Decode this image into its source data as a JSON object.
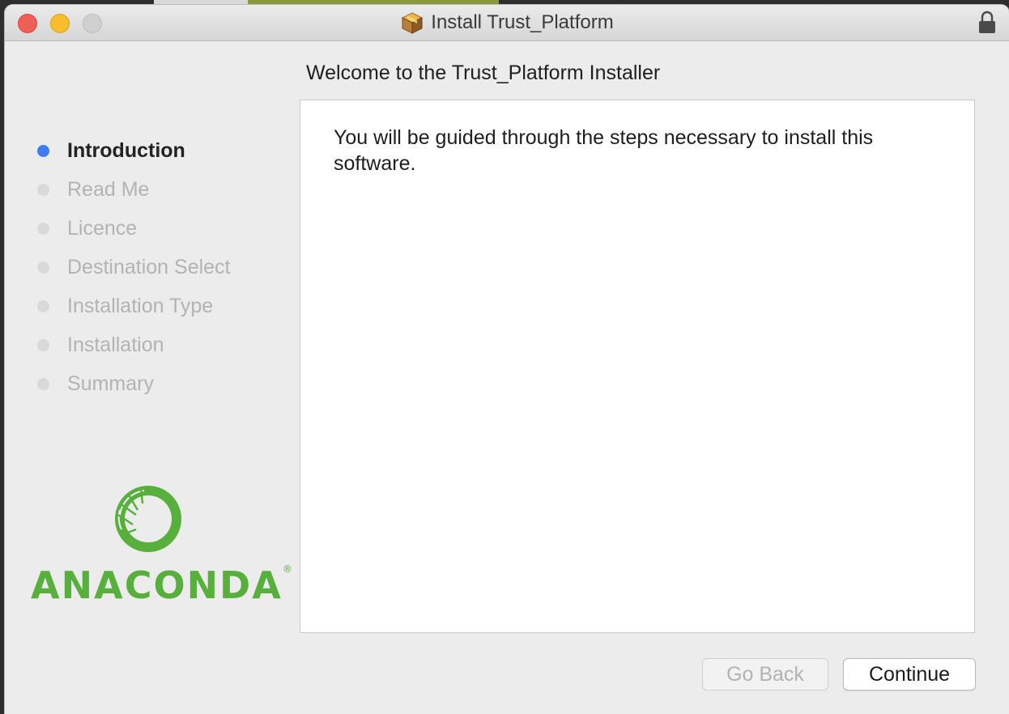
{
  "window": {
    "title": "Install Trust_Platform"
  },
  "steps": [
    {
      "label": "Introduction",
      "active": true
    },
    {
      "label": "Read Me",
      "active": false
    },
    {
      "label": "Licence",
      "active": false
    },
    {
      "label": "Destination Select",
      "active": false
    },
    {
      "label": "Installation Type",
      "active": false
    },
    {
      "label": "Installation",
      "active": false
    },
    {
      "label": "Summary",
      "active": false
    }
  ],
  "logo": {
    "wordmark": "ANACONDA",
    "registered": "®"
  },
  "main": {
    "heading": "Welcome to the Trust_Platform Installer",
    "body": "You will be guided through the steps necessary to install this software."
  },
  "buttons": {
    "back": "Go Back",
    "continue": "Continue"
  },
  "colors": {
    "active_step": "#3f7cf4",
    "anaconda_green": "#58b03c",
    "close": "#ee5f58",
    "minimize": "#f7bd2f"
  }
}
